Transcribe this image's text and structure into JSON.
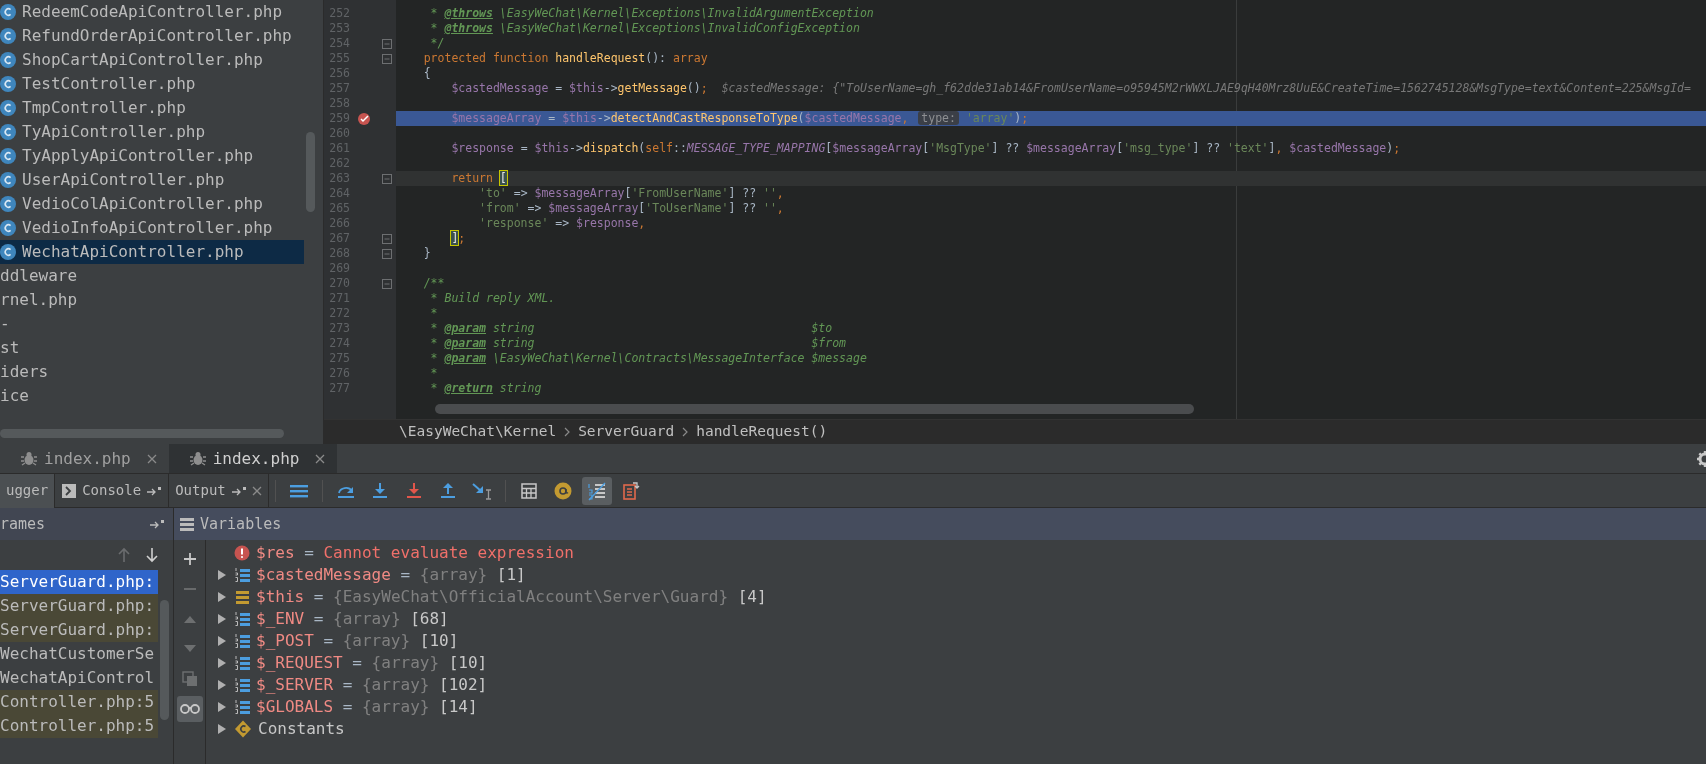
{
  "project_tree": {
    "items": [
      {
        "label": "RedeemCodeApiController.php",
        "kind": "class",
        "selected": false
      },
      {
        "label": "RefundOrderApiController.php",
        "kind": "class",
        "selected": false
      },
      {
        "label": "ShopCartApiController.php",
        "kind": "class",
        "selected": false
      },
      {
        "label": "TestController.php",
        "kind": "class",
        "selected": false
      },
      {
        "label": "TmpController.php",
        "kind": "class",
        "selected": false
      },
      {
        "label": "TyApiController.php",
        "kind": "class",
        "selected": false
      },
      {
        "label": "TyApplyApiController.php",
        "kind": "class",
        "selected": false
      },
      {
        "label": "UserApiController.php",
        "kind": "class",
        "selected": false
      },
      {
        "label": "VedioColApiController.php",
        "kind": "class",
        "selected": false
      },
      {
        "label": "VedioInfoApiController.php",
        "kind": "class",
        "selected": false
      },
      {
        "label": "WechatApiController.php",
        "kind": "class",
        "selected": true
      },
      {
        "label": "ddleware",
        "kind": "plain",
        "selected": false
      },
      {
        "label": "rnel.php",
        "kind": "plain",
        "selected": false
      },
      {
        "label": "-",
        "kind": "plain",
        "selected": false
      },
      {
        "label": "st",
        "kind": "plain",
        "selected": false
      },
      {
        "label": "iders",
        "kind": "plain",
        "selected": false
      },
      {
        "label": "ice",
        "kind": "plain",
        "selected": false
      }
    ]
  },
  "editor": {
    "lines": [
      {
        "n": "252",
        "fold": false,
        "breakpoint": false,
        "current": false,
        "caret": false,
        "t": [
          {
            "kind": "cmt",
            "text": "     * "
          },
          {
            "kind": "doc",
            "text": "@throws"
          },
          {
            "kind": "cmt",
            "text": " \\EasyWeChat\\Kernel\\Exceptions\\InvalidArgumentException"
          }
        ]
      },
      {
        "n": "253",
        "fold": false,
        "breakpoint": false,
        "current": false,
        "caret": false,
        "t": [
          {
            "kind": "cmt",
            "text": "     * "
          },
          {
            "kind": "doc",
            "text": "@throws"
          },
          {
            "kind": "cmt",
            "text": " \\EasyWeChat\\Kernel\\Exceptions\\InvalidConfigException"
          }
        ]
      },
      {
        "n": "254",
        "fold": true,
        "breakpoint": false,
        "current": false,
        "caret": false,
        "t": [
          {
            "kind": "cmt",
            "text": "     */"
          }
        ]
      },
      {
        "n": "255",
        "fold": true,
        "breakpoint": false,
        "current": false,
        "caret": false,
        "t": [
          {
            "kind": "kw",
            "text": "    protected function "
          },
          {
            "kind": "fn",
            "text": "handleRequest"
          },
          {
            "kind": "p",
            "text": "(): "
          },
          {
            "kind": "kw",
            "text": "array"
          }
        ]
      },
      {
        "n": "256",
        "fold": false,
        "breakpoint": false,
        "current": false,
        "caret": false,
        "t": [
          {
            "kind": "p",
            "text": "    {"
          }
        ]
      },
      {
        "n": "257",
        "fold": false,
        "breakpoint": false,
        "current": false,
        "caret": false,
        "t": [
          {
            "kind": "var",
            "text": "        $castedMessage"
          },
          {
            "kind": "p",
            "text": " = "
          },
          {
            "kind": "var",
            "text": "$this"
          },
          {
            "kind": "p",
            "text": "->"
          },
          {
            "kind": "fn",
            "text": "getMessage"
          },
          {
            "kind": "p",
            "text": "()"
          },
          {
            "kind": "kw",
            "text": ";"
          }
        ],
        "inline": "$castedMessage: {\"ToUserName=gh_f62dde31ab14&FromUserName=o95945M2rWWXLJAE9qH40Mrz8UuE&CreateTime=1562745128&MsgType=text&Content=225&MsgId="
      },
      {
        "n": "258",
        "fold": false,
        "breakpoint": false,
        "current": false,
        "caret": false
      },
      {
        "n": "259",
        "fold": false,
        "breakpoint": true,
        "current": true,
        "caret": false,
        "t": [
          {
            "kind": "var",
            "text": "        $messageArray"
          },
          {
            "kind": "p",
            "text": " = "
          },
          {
            "kind": "var",
            "text": "$this"
          },
          {
            "kind": "p",
            "text": "->"
          },
          {
            "kind": "fn",
            "text": "detectAndCastResponseToType"
          },
          {
            "kind": "p",
            "text": "("
          },
          {
            "kind": "var",
            "text": "$castedMessage"
          },
          {
            "kind": "kw",
            "text": ", "
          },
          {
            "kind": "hint",
            "text": "type:"
          },
          {
            "kind": "str",
            "text": " 'array'"
          },
          {
            "kind": "p",
            "text": ")"
          },
          {
            "kind": "kw",
            "text": ";"
          }
        ]
      },
      {
        "n": "260",
        "fold": false,
        "breakpoint": false,
        "current": false,
        "caret": false
      },
      {
        "n": "261",
        "fold": false,
        "breakpoint": false,
        "current": false,
        "caret": false,
        "t": [
          {
            "kind": "var",
            "text": "        $response"
          },
          {
            "kind": "p",
            "text": " = "
          },
          {
            "kind": "var",
            "text": "$this"
          },
          {
            "kind": "p",
            "text": "->"
          },
          {
            "kind": "fn",
            "text": "dispatch"
          },
          {
            "kind": "p",
            "text": "("
          },
          {
            "kind": "kw",
            "text": "self"
          },
          {
            "kind": "p",
            "text": "::"
          },
          {
            "kind": "const",
            "text": "MESSAGE_TYPE_MAPPING"
          },
          {
            "kind": "p",
            "text": "["
          },
          {
            "kind": "var",
            "text": "$messageArray"
          },
          {
            "kind": "p",
            "text": "["
          },
          {
            "kind": "str",
            "text": "'MsgType'"
          },
          {
            "kind": "p",
            "text": "] ?? "
          },
          {
            "kind": "var",
            "text": "$messageArray"
          },
          {
            "kind": "p",
            "text": "["
          },
          {
            "kind": "str",
            "text": "'msg_type'"
          },
          {
            "kind": "p",
            "text": "] ?? "
          },
          {
            "kind": "str",
            "text": "'text'"
          },
          {
            "kind": "p",
            "text": "]"
          },
          {
            "kind": "kw",
            "text": ", "
          },
          {
            "kind": "var",
            "text": "$castedMessage"
          },
          {
            "kind": "p",
            "text": ")"
          },
          {
            "kind": "kw",
            "text": ";"
          }
        ]
      },
      {
        "n": "262",
        "fold": false,
        "breakpoint": false,
        "current": false,
        "caret": false
      },
      {
        "n": "263",
        "fold": true,
        "breakpoint": false,
        "current": false,
        "caret": true,
        "t": [
          {
            "kind": "kw",
            "text": "        return "
          },
          {
            "kind": "match",
            "text": "["
          }
        ]
      },
      {
        "n": "264",
        "fold": false,
        "breakpoint": false,
        "current": false,
        "caret": false,
        "t": [
          {
            "kind": "str",
            "text": "            'to'"
          },
          {
            "kind": "p",
            "text": " => "
          },
          {
            "kind": "var",
            "text": "$messageArray"
          },
          {
            "kind": "p",
            "text": "["
          },
          {
            "kind": "str",
            "text": "'FromUserName'"
          },
          {
            "kind": "p",
            "text": "] ?? "
          },
          {
            "kind": "str",
            "text": "''"
          },
          {
            "kind": "kw",
            "text": ","
          }
        ]
      },
      {
        "n": "265",
        "fold": false,
        "breakpoint": false,
        "current": false,
        "caret": false,
        "t": [
          {
            "kind": "str",
            "text": "            'from'"
          },
          {
            "kind": "p",
            "text": " => "
          },
          {
            "kind": "var",
            "text": "$messageArray"
          },
          {
            "kind": "p",
            "text": "["
          },
          {
            "kind": "str",
            "text": "'ToUserName'"
          },
          {
            "kind": "p",
            "text": "] ?? "
          },
          {
            "kind": "str",
            "text": "''"
          },
          {
            "kind": "kw",
            "text": ","
          }
        ]
      },
      {
        "n": "266",
        "fold": false,
        "breakpoint": false,
        "current": false,
        "caret": false,
        "t": [
          {
            "kind": "str",
            "text": "            'response'"
          },
          {
            "kind": "p",
            "text": " => "
          },
          {
            "kind": "var",
            "text": "$response"
          },
          {
            "kind": "kw",
            "text": ","
          }
        ]
      },
      {
        "n": "267",
        "fold": true,
        "breakpoint": false,
        "current": false,
        "caret": false,
        "t": [
          {
            "kind": "match_end",
            "text": "        ]"
          },
          {
            "kind": "kw",
            "text": ";"
          }
        ]
      },
      {
        "n": "268",
        "fold": true,
        "breakpoint": false,
        "current": false,
        "caret": false,
        "t": [
          {
            "kind": "p",
            "text": "    }"
          }
        ]
      },
      {
        "n": "269",
        "fold": false,
        "breakpoint": false,
        "current": false,
        "caret": false
      },
      {
        "n": "270",
        "fold": true,
        "breakpoint": false,
        "current": false,
        "caret": false,
        "t": [
          {
            "kind": "cmt",
            "text": "    /**"
          }
        ]
      },
      {
        "n": "271",
        "fold": false,
        "breakpoint": false,
        "current": false,
        "caret": false,
        "t": [
          {
            "kind": "cmt",
            "text": "     * Build reply XML."
          }
        ]
      },
      {
        "n": "272",
        "fold": false,
        "breakpoint": false,
        "current": false,
        "caret": false,
        "t": [
          {
            "kind": "cmt",
            "text": "     *"
          }
        ]
      },
      {
        "n": "273",
        "fold": false,
        "breakpoint": false,
        "current": false,
        "caret": false,
        "t": [
          {
            "kind": "cmt",
            "text": "     * "
          },
          {
            "kind": "doc",
            "text": "@param"
          },
          {
            "kind": "cmt",
            "text": " string                                        $to"
          }
        ]
      },
      {
        "n": "274",
        "fold": false,
        "breakpoint": false,
        "current": false,
        "caret": false,
        "t": [
          {
            "kind": "cmt",
            "text": "     * "
          },
          {
            "kind": "doc",
            "text": "@param"
          },
          {
            "kind": "cmt",
            "text": " string                                        $from"
          }
        ]
      },
      {
        "n": "275",
        "fold": false,
        "breakpoint": false,
        "current": false,
        "caret": false,
        "t": [
          {
            "kind": "cmt",
            "text": "     * "
          },
          {
            "kind": "doc",
            "text": "@param"
          },
          {
            "kind": "cmt",
            "text": " \\EasyWeChat\\Kernel\\Contracts\\MessageInterface $message"
          }
        ]
      },
      {
        "n": "276",
        "fold": false,
        "breakpoint": false,
        "current": false,
        "caret": false,
        "t": [
          {
            "kind": "cmt",
            "text": "     *"
          }
        ]
      },
      {
        "n": "277",
        "fold": false,
        "breakpoint": false,
        "current": false,
        "caret": false,
        "t": [
          {
            "kind": "cmt",
            "text": "     * "
          },
          {
            "kind": "doc",
            "text": "@return"
          },
          {
            "kind": "cmt",
            "text": " string"
          }
        ]
      }
    ],
    "breadcrumb": [
      "\\EasyWeChat\\Kernel",
      "ServerGuard",
      "handleRequest()"
    ]
  },
  "run_tabs": [
    {
      "label": "index.php",
      "selected": false
    },
    {
      "label": "index.php",
      "selected": true
    }
  ],
  "debug_tabs": [
    {
      "label": "ugger",
      "kind": "plain",
      "selected": true
    },
    {
      "label": "Console",
      "kind": "console",
      "selected": false
    },
    {
      "label": "Output",
      "kind": "output",
      "selected": false
    }
  ],
  "toolbar": [
    {
      "kind": "layout",
      "selected": false
    },
    {
      "kind": "step-over",
      "selected": false
    },
    {
      "kind": "step-into",
      "selected": false
    },
    {
      "kind": "force-step-into",
      "selected": false
    },
    {
      "kind": "step-out",
      "selected": false
    },
    {
      "kind": "run-to-cursor",
      "selected": false
    },
    {
      "kind": "evaluate",
      "selected": false
    },
    {
      "kind": "watch",
      "selected": false
    },
    {
      "kind": "inline-values",
      "selected": true
    },
    {
      "kind": "restore",
      "selected": false
    }
  ],
  "frames": {
    "title": "rames",
    "items": [
      {
        "label": "ServerGuard.php:",
        "kind": "vendor",
        "selected": true
      },
      {
        "label": "ServerGuard.php:",
        "kind": "vendor",
        "selected": false
      },
      {
        "label": "ServerGuard.php:",
        "kind": "vendor",
        "selected": false
      },
      {
        "label": "WechatCustomerSe",
        "kind": "app",
        "selected": false
      },
      {
        "label": "WechatApiControl",
        "kind": "app",
        "selected": false
      },
      {
        "label": "Controller.php:5",
        "kind": "vendor",
        "selected": false
      },
      {
        "label": "Controller.php:5",
        "kind": "vendor",
        "selected": false
      }
    ]
  },
  "side_toolbar": [
    {
      "kind": "add",
      "disabled": false,
      "selected": false
    },
    {
      "kind": "remove",
      "disabled": true,
      "selected": false
    },
    {
      "kind": "up",
      "disabled": true,
      "selected": false
    },
    {
      "kind": "down",
      "disabled": true,
      "selected": false
    },
    {
      "kind": "copy",
      "disabled": true,
      "selected": false
    },
    {
      "kind": "glasses",
      "disabled": false,
      "selected": true
    }
  ],
  "variables": {
    "title": "Variables",
    "items": [
      {
        "kind": "error",
        "name": "$res",
        "sep": "=",
        "value": "Cannot evaluate expression"
      },
      {
        "kind": "array",
        "name": "$castedMessage",
        "sep": "=",
        "type": "{array}",
        "count": "[1]"
      },
      {
        "kind": "object",
        "name": "$this",
        "sep": "=",
        "type": "{EasyWeChat\\OfficialAccount\\Server\\Guard}",
        "count": "[4]"
      },
      {
        "kind": "array",
        "name": "$_ENV",
        "sep": "=",
        "type": "{array}",
        "count": "[68]"
      },
      {
        "kind": "array",
        "name": "$_POST",
        "sep": "=",
        "type": "{array}",
        "count": "[10]"
      },
      {
        "kind": "array",
        "name": "$_REQUEST",
        "sep": "=",
        "type": "{array}",
        "count": "[10]"
      },
      {
        "kind": "array",
        "name": "$_SERVER",
        "sep": "=",
        "type": "{array}",
        "count": "[102]"
      },
      {
        "kind": "array",
        "name": "$GLOBALS",
        "sep": "=",
        "type": "{array}",
        "count": "[14]"
      },
      {
        "kind": "constants",
        "name": "Constants"
      }
    ]
  }
}
